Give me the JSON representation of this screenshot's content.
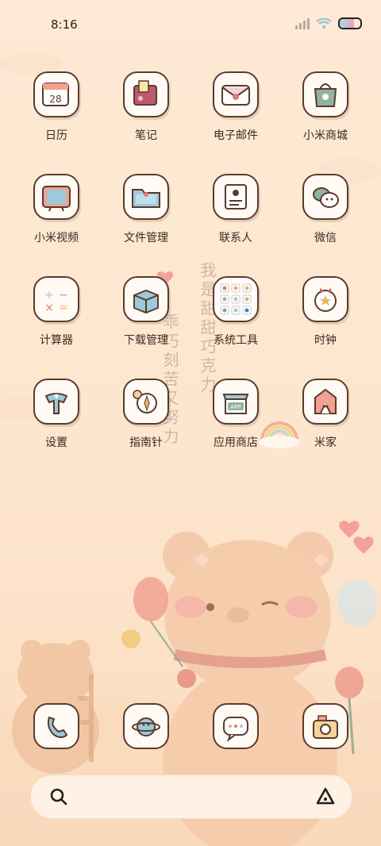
{
  "status_bar": {
    "time": "8:16",
    "icons": [
      "signal-icon",
      "wifi-icon",
      "battery-icon"
    ],
    "battery_level": 0.7
  },
  "wallpaper": {
    "vertical_text": [
      "我是甜甜巧克力",
      "乖巧刻苦又努力"
    ],
    "colors": {
      "background": "#fde9d4",
      "bear": "#f4c9a8",
      "heart": "#f3a19a"
    }
  },
  "apps": [
    {
      "label": "日历",
      "icon": "calendar-icon",
      "date": "28"
    },
    {
      "label": "笔记",
      "icon": "notes-icon"
    },
    {
      "label": "电子邮件",
      "icon": "email-icon"
    },
    {
      "label": "小米商城",
      "icon": "mi-store-icon"
    },
    {
      "label": "小米视频",
      "icon": "tv-icon"
    },
    {
      "label": "文件管理",
      "icon": "folder-icon"
    },
    {
      "label": "联系人",
      "icon": "contacts-icon"
    },
    {
      "label": "微信",
      "icon": "wechat-icon"
    },
    {
      "label": "计算器",
      "icon": "calculator-icon"
    },
    {
      "label": "下载管理",
      "icon": "download-box-icon"
    },
    {
      "label": "系统工具",
      "icon": "folder-system-tools-icon"
    },
    {
      "label": "时钟",
      "icon": "clock-icon"
    },
    {
      "label": "设置",
      "icon": "settings-icon"
    },
    {
      "label": "指南针",
      "icon": "compass-icon"
    },
    {
      "label": "应用商店",
      "icon": "app-store-icon",
      "badge_text": "APP"
    },
    {
      "label": "米家",
      "icon": "mi-home-icon"
    }
  ],
  "dock": [
    {
      "icon": "phone-icon"
    },
    {
      "icon": "browser-planet-icon"
    },
    {
      "icon": "messages-icon"
    },
    {
      "icon": "camera-icon"
    }
  ],
  "search_bar": {
    "left_icon": "search-icon",
    "right_icon": "assistant-icon"
  }
}
